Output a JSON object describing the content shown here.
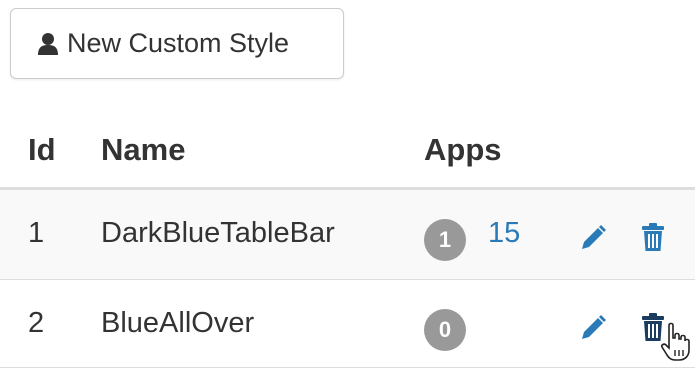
{
  "toolbar": {
    "new_button_label": "New Custom Style",
    "new_button_icon": "user-icon"
  },
  "table": {
    "columns": [
      "Id",
      "Name",
      "Apps"
    ],
    "rows": [
      {
        "id": "1",
        "name": "DarkBlueTableBar",
        "count": "1",
        "apps_link": "15"
      },
      {
        "id": "2",
        "name": "BlueAllOver",
        "count": "0",
        "apps_link": ""
      }
    ]
  },
  "colors": {
    "link": "#2a7ab7",
    "badge": "#999999",
    "row_stripe": "#f9f9f9",
    "border": "#dddddd"
  },
  "icons": [
    "user-icon",
    "pencil-icon",
    "trash-icon",
    "hand-cursor-icon"
  ]
}
